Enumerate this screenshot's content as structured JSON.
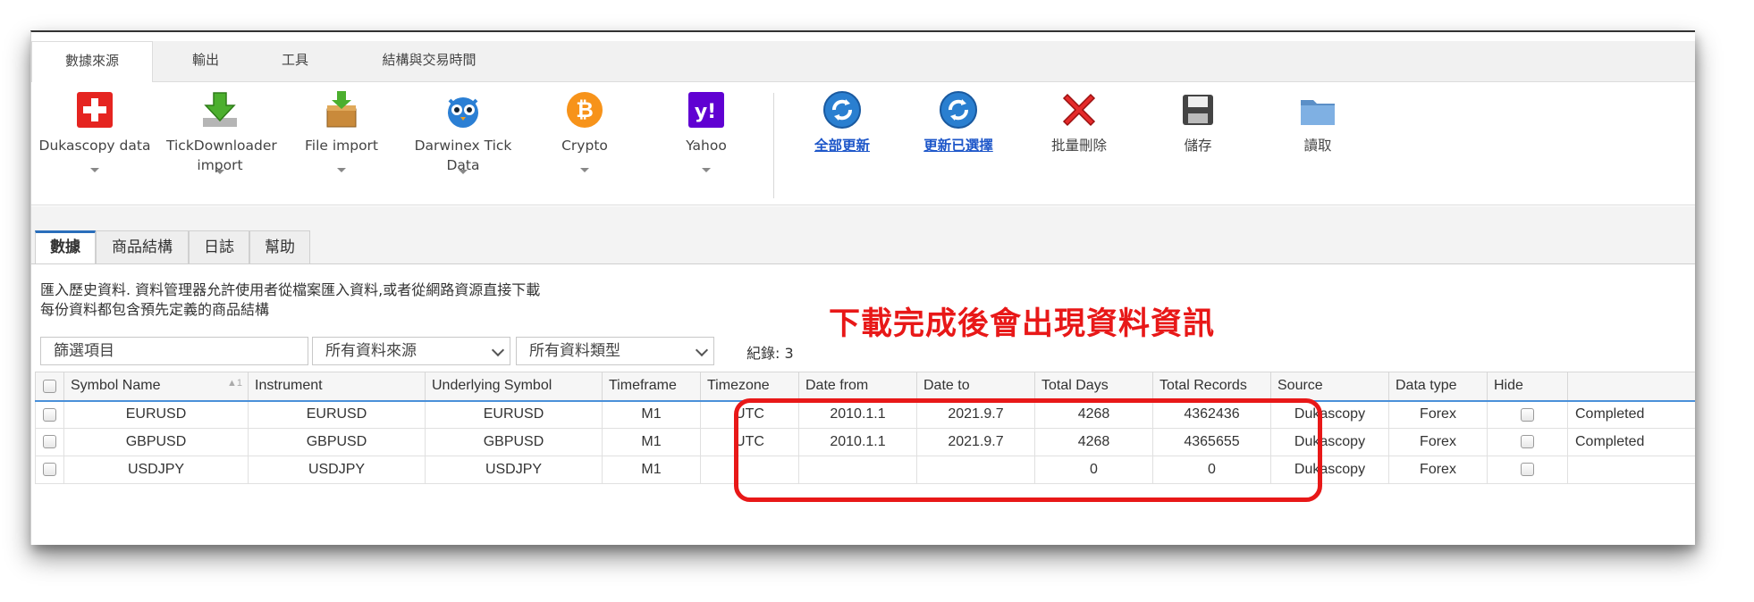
{
  "ribbon": {
    "tabs": [
      "數據來源",
      "輸出",
      "工具",
      "結構與交易時間"
    ],
    "buttons": [
      {
        "label": "Dukascopy data",
        "icon": "swiss-flag-icon"
      },
      {
        "label": "TickDownloader import",
        "icon": "download-arrow-icon"
      },
      {
        "label": "File import",
        "icon": "box-import-icon"
      },
      {
        "label": "Darwinex Tick Data",
        "icon": "owl-icon"
      },
      {
        "label": "Crypto",
        "icon": "bitcoin-icon"
      },
      {
        "label": "Yahoo",
        "icon": "yahoo-icon"
      },
      {
        "label": "全部更新",
        "icon": "refresh-icon"
      },
      {
        "label": "更新已選擇",
        "icon": "refresh-icon"
      },
      {
        "label": "批量刪除",
        "icon": "red-x-icon"
      },
      {
        "label": "儲存",
        "icon": "floppy-disk-icon"
      },
      {
        "label": "讀取",
        "icon": "folder-icon"
      }
    ]
  },
  "tabs": [
    "數據",
    "商品結構",
    "日誌",
    "幫助"
  ],
  "description": {
    "line1": "匯入歷史資料. 資料管理器允許使用者從檔案匯入資料,或者從網路資源直接下載",
    "line2": "每份資料都包含預先定義的商品結構"
  },
  "filters": {
    "search_placeholder": "篩選項目",
    "source": "所有資料來源",
    "type": "所有資料類型",
    "count": "紀錄: 3"
  },
  "annotation": "下載完成後會出現資料資訊",
  "grid": {
    "columns": [
      "Symbol Name",
      "Instrument",
      "Underlying Symbol",
      "Timeframe",
      "Timezone",
      "Date from",
      "Date to",
      "Total Days",
      "Total Records",
      "Source",
      "Data type",
      "Hide",
      ""
    ],
    "sort_indicator": "▲1",
    "rows": [
      {
        "symbol": "EURUSD",
        "instrument": "EURUSD",
        "underlying": "EURUSD",
        "timeframe": "M1",
        "timezone": "UTC",
        "date_from": "2010.1.1",
        "date_to": "2021.9.7",
        "total_days": "4268",
        "total_records": "4362436",
        "source": "Dukascopy",
        "data_type": "Forex",
        "status": "Completed"
      },
      {
        "symbol": "GBPUSD",
        "instrument": "GBPUSD",
        "underlying": "GBPUSD",
        "timeframe": "M1",
        "timezone": "UTC",
        "date_from": "2010.1.1",
        "date_to": "2021.9.7",
        "total_days": "4268",
        "total_records": "4365655",
        "source": "Dukascopy",
        "data_type": "Forex",
        "status": "Completed"
      },
      {
        "symbol": "USDJPY",
        "instrument": "USDJPY",
        "underlying": "USDJPY",
        "timeframe": "M1",
        "timezone": "",
        "date_from": "",
        "date_to": "",
        "total_days": "0",
        "total_records": "0",
        "source": "Dukascopy",
        "data_type": "Forex",
        "status": ""
      }
    ]
  },
  "colors": {
    "accent": "#2a6ebb",
    "highlight": "#e81818",
    "link": "#1d56c9"
  }
}
